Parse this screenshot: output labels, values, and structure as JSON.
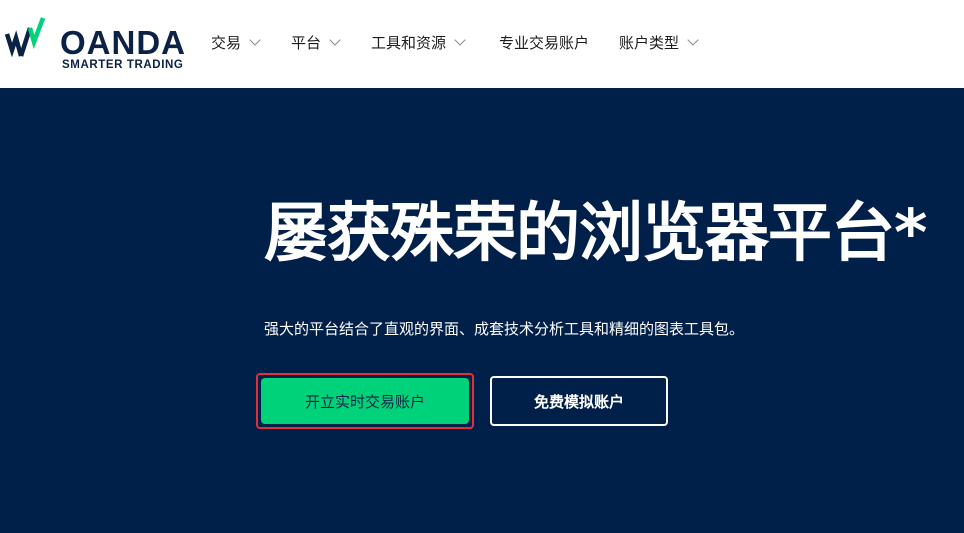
{
  "brand": {
    "name": "OANDA",
    "tagline": "SMARTER TRADING"
  },
  "nav": {
    "items": [
      {
        "label": "交易",
        "dropdown": true
      },
      {
        "label": "平台",
        "dropdown": true
      },
      {
        "label": "工具和资源",
        "dropdown": true
      },
      {
        "label": "专业交易账户",
        "dropdown": false
      },
      {
        "label": "账户类型",
        "dropdown": true
      }
    ]
  },
  "hero": {
    "headline": "屡获殊荣的浏览器平台*",
    "subtext": "强大的平台结合了直观的界面、成套技术分析工具和精细的图表工具包。",
    "primary_button": "开立实时交易账户",
    "secondary_button": "免费模拟账户"
  },
  "colors": {
    "hero_bg": "#00204a",
    "primary": "#00d27a",
    "brand_text": "#0b2146",
    "highlight": "#e0303a"
  }
}
